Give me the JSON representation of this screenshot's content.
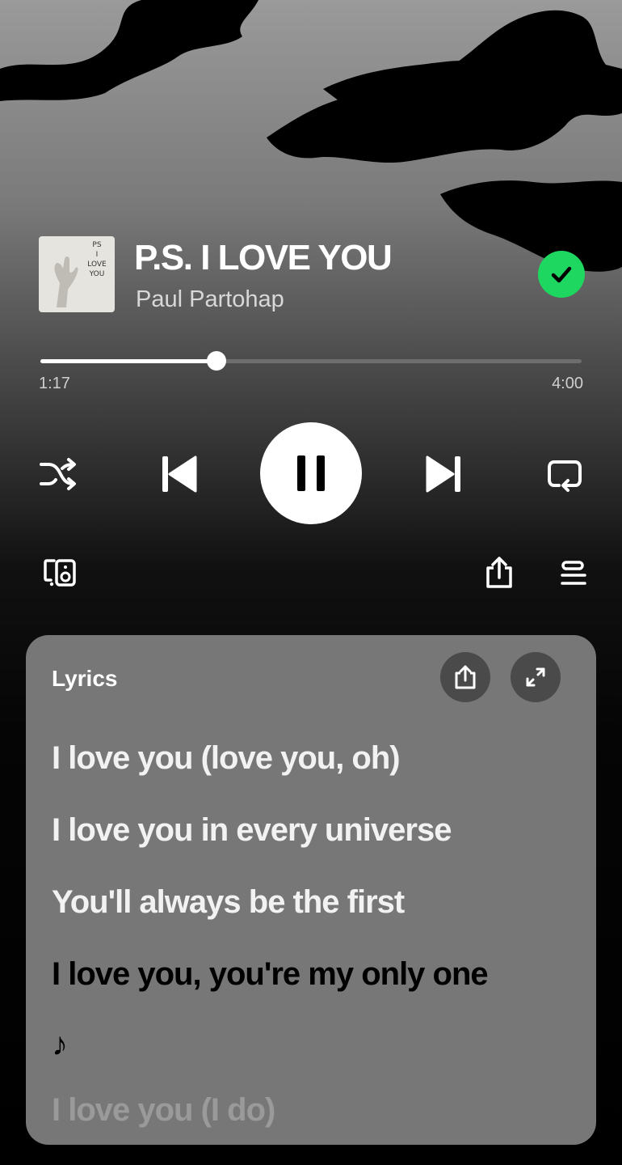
{
  "now_playing": {
    "title": "P.S. I LOVE YOU",
    "artist": "Paul Partohap",
    "cover_text": [
      "PS",
      "I",
      "LOVE",
      "YOU"
    ],
    "saved": true
  },
  "progress": {
    "elapsed": "1:17",
    "total": "4:00",
    "fraction": 0.325
  },
  "controls": [
    "shuffle-icon",
    "previous-icon",
    "pause-icon",
    "next-icon",
    "repeat-icon"
  ],
  "secondary_controls": [
    "connect-device-icon",
    "share-icon",
    "queue-icon"
  ],
  "lyrics": {
    "header": "Lyrics",
    "lines": [
      {
        "text": "I love you (love you, oh)",
        "state": "past"
      },
      {
        "text": "I love you in every universe",
        "state": "past"
      },
      {
        "text": "You'll always be the first",
        "state": "past"
      },
      {
        "text": "I love you, you're my only one",
        "state": "current"
      },
      {
        "text": "♪",
        "state": "current"
      },
      {
        "text": "I love you (I do)",
        "state": "faded"
      }
    ]
  },
  "colors": {
    "accent_green": "#1ed760",
    "lyrics_card": "#777777",
    "card_button": "#4a4a4a"
  }
}
